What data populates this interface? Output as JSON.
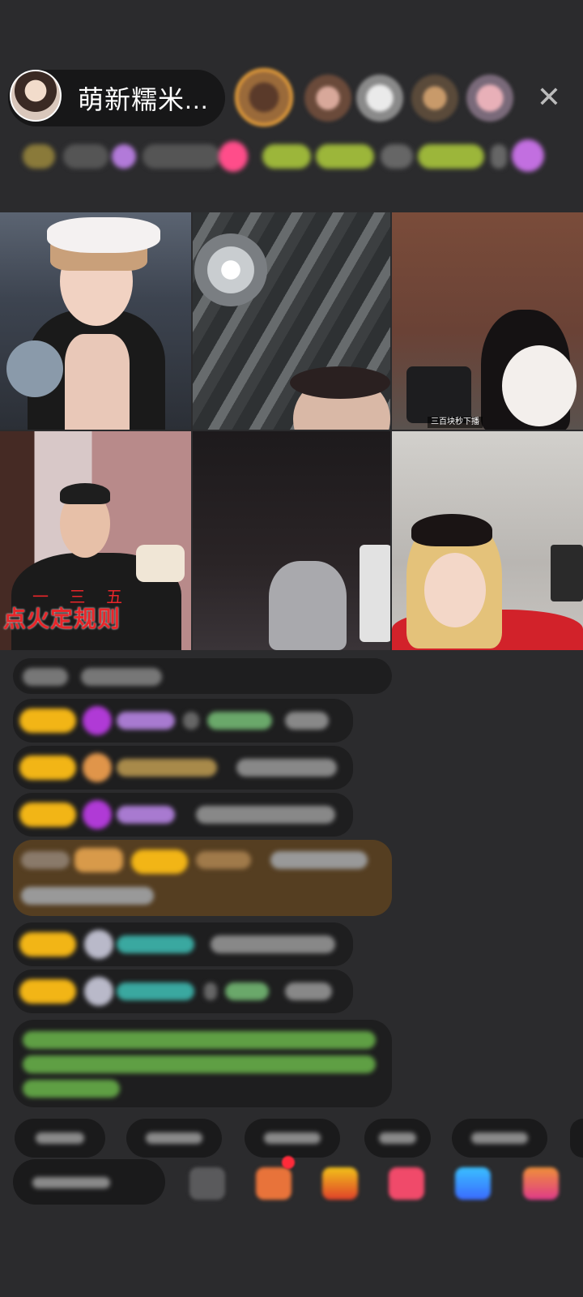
{
  "host": {
    "name": "萌新糯米...",
    "avatar_icon": "host-avatar-portrait"
  },
  "top_bar": {
    "audience_icons": [
      "viewer-avatar",
      "viewer-avatar",
      "viewer-avatar",
      "viewer-avatar",
      "viewer-avatar"
    ],
    "close_glyph": "✕"
  },
  "video_grid": {
    "tile_caption": "三百块秒下播",
    "rule_marks": "一 三 五",
    "rule_text": "点火定规则"
  },
  "colors": {
    "background": "#2b2b2d",
    "level_badge": "#f2b516",
    "gift_badge_red": "#ff2b3a",
    "rule_text_red": "#e8262a",
    "chat_green": "#7fd36a"
  }
}
